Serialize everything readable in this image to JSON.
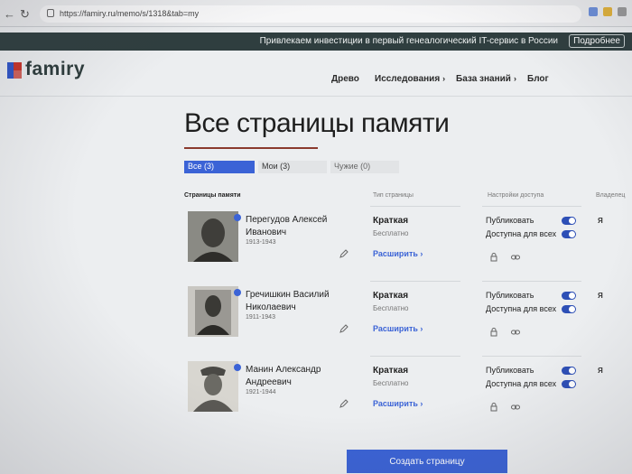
{
  "browser": {
    "url": "https://famiry.ru/memo/s/1318&tab=my"
  },
  "promo": {
    "text": "Привлекаем инвестиции в первый генеалогический IT-сервис в России",
    "button": "Подробнее"
  },
  "header": {
    "logo": "famiry",
    "nav": [
      {
        "label": "Древо"
      },
      {
        "label": "Исследования"
      },
      {
        "label": "База знаний"
      },
      {
        "label": "Блог"
      }
    ]
  },
  "page": {
    "title": "Все страницы памяти",
    "tabs": [
      {
        "label": "Все (3)"
      },
      {
        "label": "Мои (3)"
      },
      {
        "label": "Чужие (0)"
      }
    ],
    "columns": {
      "pages": "Страницы памяти",
      "type": "Тип страницы",
      "access": "Настройки доступа",
      "owner": "Владелец"
    },
    "rows": [
      {
        "name": "Перегудов Алексей Иванович",
        "years": "1913-1943",
        "type": "Краткая",
        "price": "Бесплатно",
        "expand": "Расширить",
        "publish": "Публиковать",
        "public": "Доступна для всех",
        "owner": "Я"
      },
      {
        "name": "Гречишкин Василий Николаевич",
        "years": "1911-1943",
        "type": "Краткая",
        "price": "Бесплатно",
        "expand": "Расширить",
        "publish": "Публиковать",
        "public": "Доступна для всех",
        "owner": "Я"
      },
      {
        "name": "Манин Александр Андреевич",
        "years": "1921-1944",
        "type": "Краткая",
        "price": "Бесплатно",
        "expand": "Расширить",
        "publish": "Публиковать",
        "public": "Доступна для всех",
        "owner": "Я"
      }
    ],
    "create_button": "Создать страницу"
  },
  "colors": {
    "accent": "#3b63d6",
    "promo_bg": "#2f3e3f",
    "title_rule": "#8a3a2e"
  }
}
